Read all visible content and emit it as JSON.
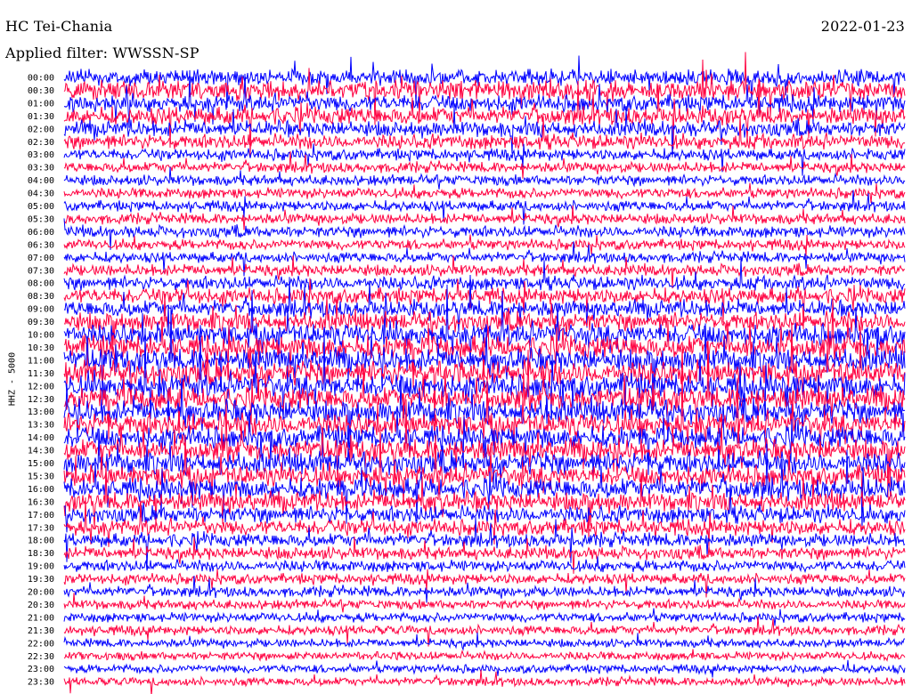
{
  "header": {
    "station": "HC Tei-Chania",
    "date": "2022-01-23",
    "filter": "Applied filter: WWSSN-SP"
  },
  "chart_data": {
    "type": "line",
    "title": "HC Tei-Chania",
    "date": "2022-01-23",
    "subtitle": "Applied filter: WWSSN-SP",
    "ylabel": "HHZ - 5000",
    "xlabel": "",
    "grid": false,
    "legend": "none",
    "trace_colors": [
      "#0000ff",
      "#ff0040"
    ],
    "rows": [
      {
        "label": "00:00",
        "activity": 0.55
      },
      {
        "label": "00:30",
        "activity": 0.7
      },
      {
        "label": "01:00",
        "activity": 0.6
      },
      {
        "label": "01:30",
        "activity": 0.65
      },
      {
        "label": "02:00",
        "activity": 0.55
      },
      {
        "label": "02:30",
        "activity": 0.5
      },
      {
        "label": "03:00",
        "activity": 0.35
      },
      {
        "label": "03:30",
        "activity": 0.3
      },
      {
        "label": "04:00",
        "activity": 0.3
      },
      {
        "label": "04:30",
        "activity": 0.3
      },
      {
        "label": "05:00",
        "activity": 0.3
      },
      {
        "label": "05:30",
        "activity": 0.3
      },
      {
        "label": "06:00",
        "activity": 0.35
      },
      {
        "label": "06:30",
        "activity": 0.3
      },
      {
        "label": "07:00",
        "activity": 0.3
      },
      {
        "label": "07:30",
        "activity": 0.35
      },
      {
        "label": "08:00",
        "activity": 0.45
      },
      {
        "label": "08:30",
        "activity": 0.55
      },
      {
        "label": "09:00",
        "activity": 0.6
      },
      {
        "label": "09:30",
        "activity": 0.7
      },
      {
        "label": "10:00",
        "activity": 0.85
      },
      {
        "label": "10:30",
        "activity": 0.9
      },
      {
        "label": "11:00",
        "activity": 0.9
      },
      {
        "label": "11:30",
        "activity": 0.95
      },
      {
        "label": "12:00",
        "activity": 0.95
      },
      {
        "label": "12:30",
        "activity": 0.9
      },
      {
        "label": "13:00",
        "activity": 0.9
      },
      {
        "label": "13:30",
        "activity": 0.9
      },
      {
        "label": "14:00",
        "activity": 0.85
      },
      {
        "label": "14:30",
        "activity": 0.85
      },
      {
        "label": "15:00",
        "activity": 0.85
      },
      {
        "label": "15:30",
        "activity": 0.8
      },
      {
        "label": "16:00",
        "activity": 0.8
      },
      {
        "label": "16:30",
        "activity": 0.7
      },
      {
        "label": "17:00",
        "activity": 0.6
      },
      {
        "label": "17:30",
        "activity": 0.55
      },
      {
        "label": "18:00",
        "activity": 0.45
      },
      {
        "label": "18:30",
        "activity": 0.4
      },
      {
        "label": "19:00",
        "activity": 0.35
      },
      {
        "label": "19:30",
        "activity": 0.3
      },
      {
        "label": "20:00",
        "activity": 0.3
      },
      {
        "label": "20:30",
        "activity": 0.25
      },
      {
        "label": "21:00",
        "activity": 0.25
      },
      {
        "label": "21:30",
        "activity": 0.25
      },
      {
        "label": "22:00",
        "activity": 0.2
      },
      {
        "label": "22:30",
        "activity": 0.2
      },
      {
        "label": "23:00",
        "activity": 0.2
      },
      {
        "label": "23:30",
        "activity": 0.2
      }
    ]
  }
}
